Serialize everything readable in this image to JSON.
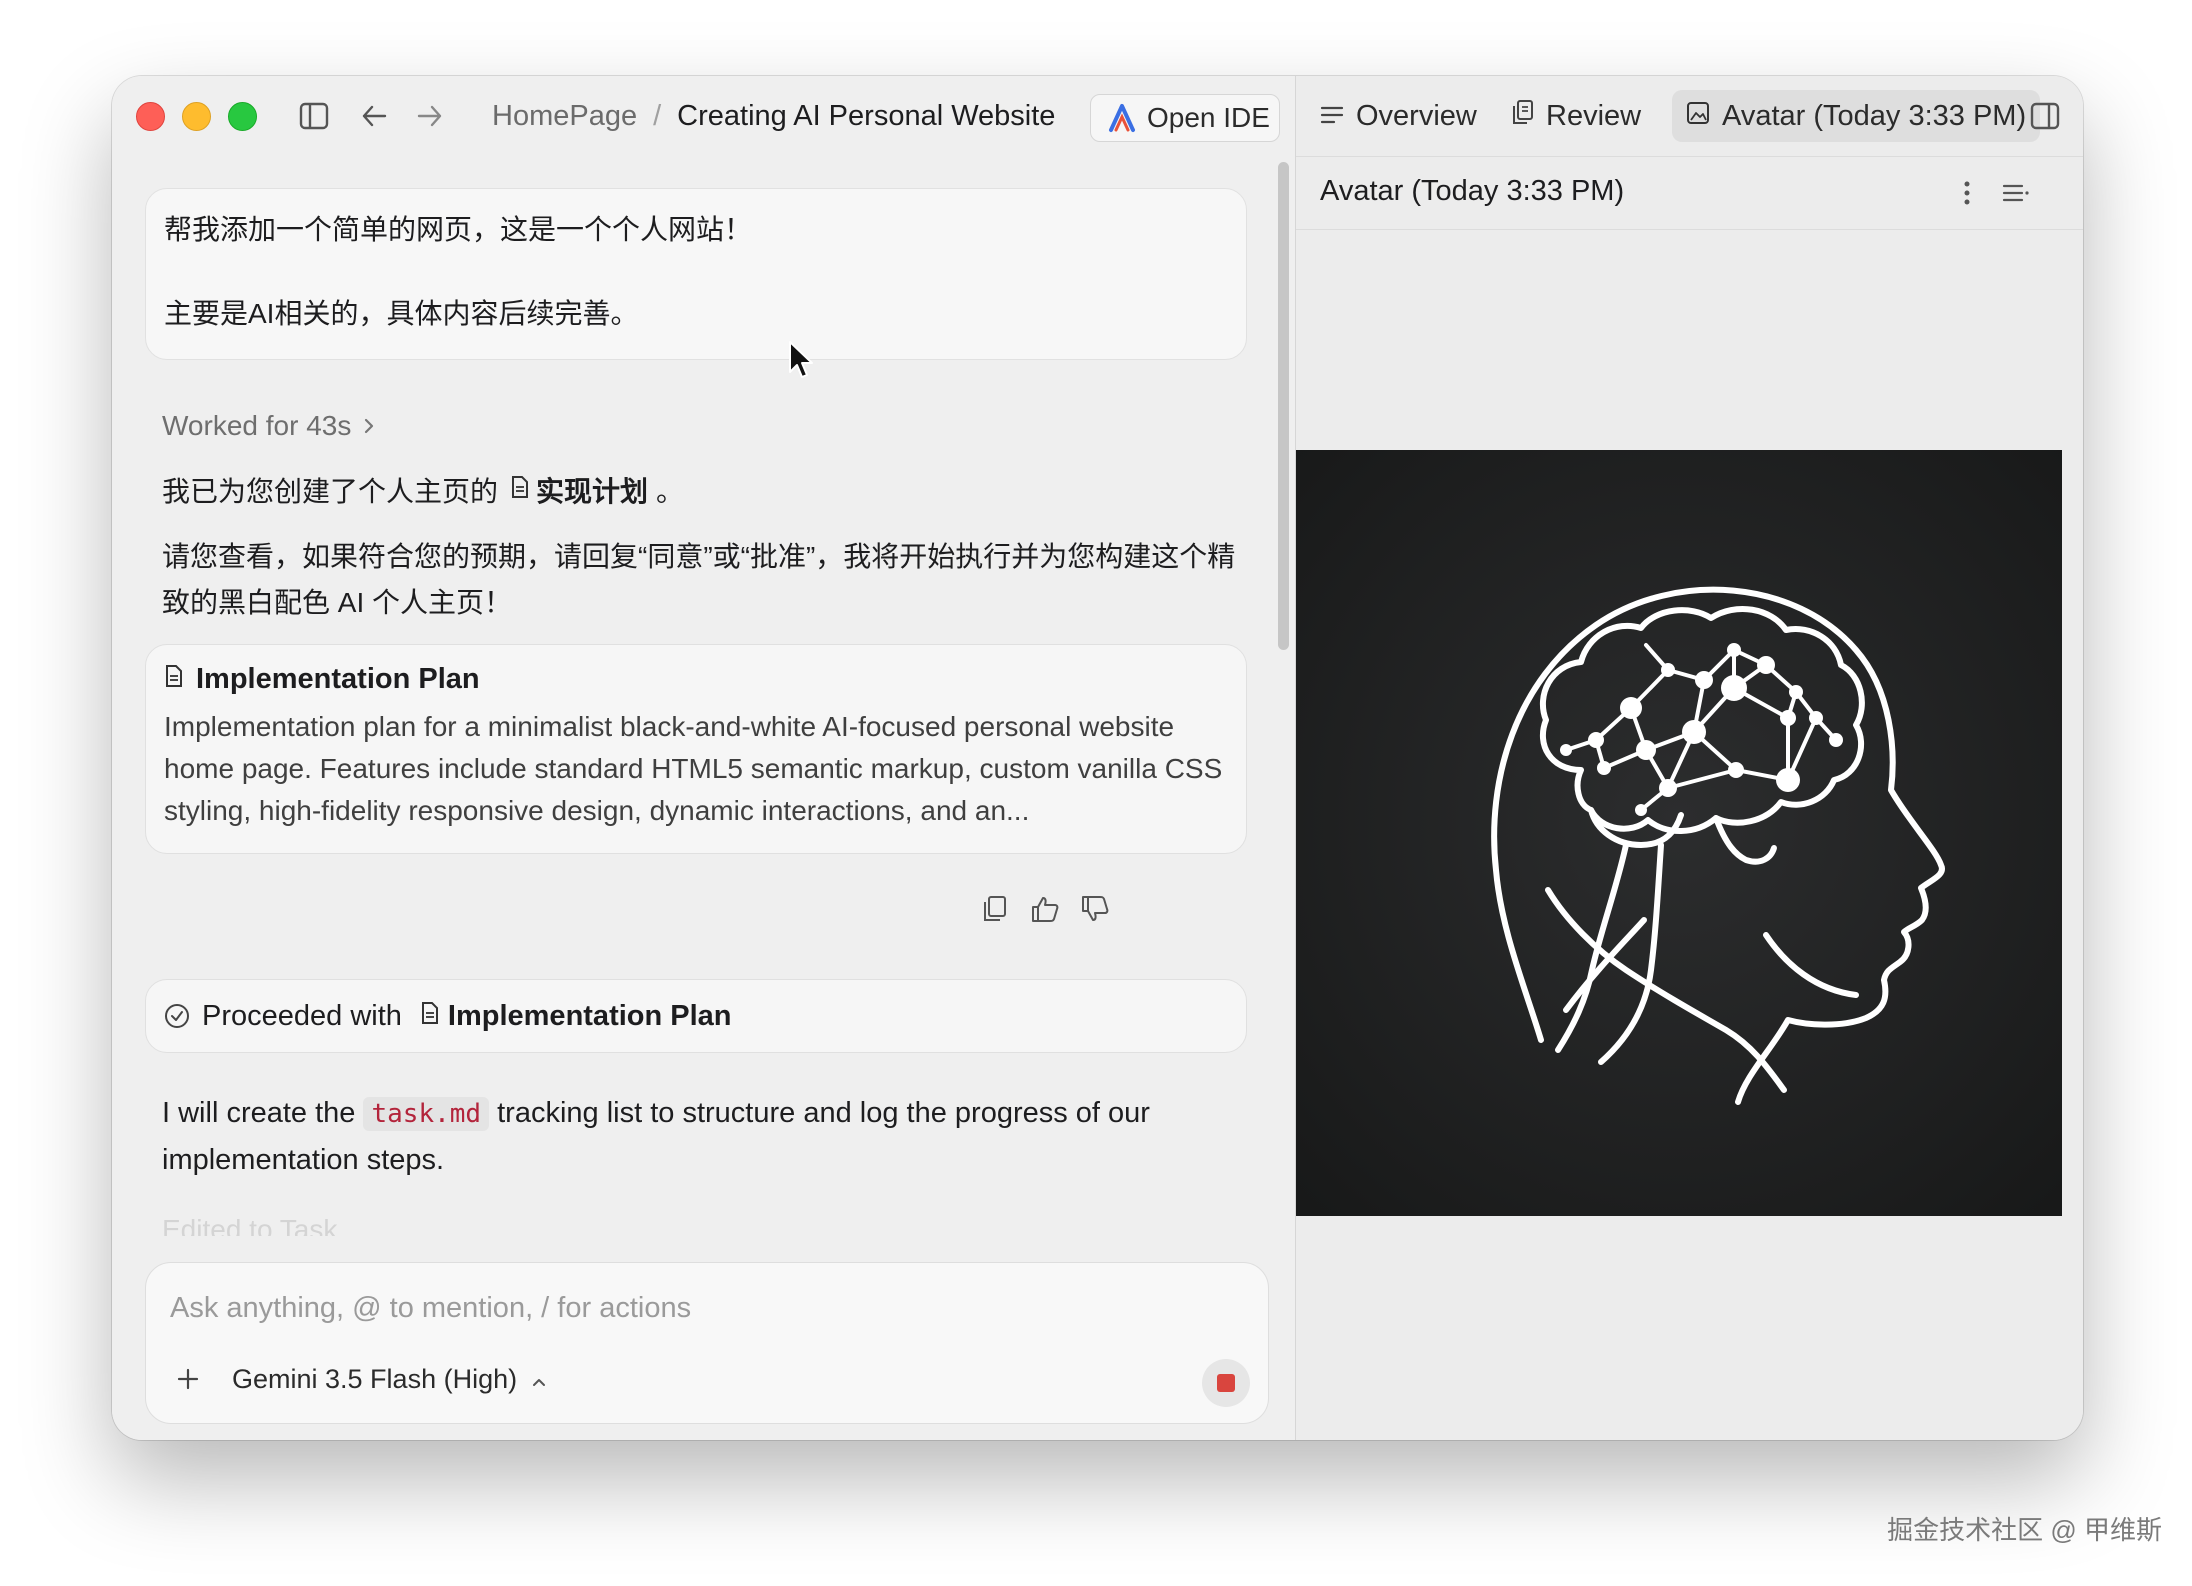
{
  "titlebar": {
    "breadcrumb_home": "HomePage",
    "breadcrumb_sep": "/",
    "breadcrumb_current": "Creating AI Personal Website",
    "open_ide_label": "Open IDE"
  },
  "conversation": {
    "user_message_line1": "帮我添加一个简单的网页，这是一个个人网站！",
    "user_message_line2": "主要是AI相关的，具体内容后续完善。",
    "worked_label": "Worked for 43s",
    "reply1_prefix": "我已为您创建了个人主页的",
    "reply1_link": "实现计划",
    "reply1_suffix": "。",
    "reply2": "请您查看，如果符合您的预期，请回复“同意”或“批准”，我将开始执行并为您构建这个精致的黑白配色 AI 个人主页！",
    "plan_card_title": "Implementation Plan",
    "plan_card_desc": "Implementation plan for a minimalist black-and-white AI-focused personal website home page. Features include standard HTML5 semantic markup, custom vanilla CSS styling, high-fidelity responsive design, dynamic interactions, and an...",
    "proceeded_prefix": "Proceeded with",
    "proceeded_link": "Implementation Plan",
    "reply3_before": "I will create the",
    "reply3_code": "task.md",
    "reply3_after": "tracking list to structure and log the progress of our implementation steps.",
    "faded_text": "Edited  to Task"
  },
  "composer": {
    "placeholder": "Ask anything, @ to mention, / for actions",
    "value": "",
    "model_label": "Gemini 3.5 Flash (High)"
  },
  "right_panel": {
    "tabs": [
      "Overview",
      "Review",
      "Avatar (Today 3:33 PM)"
    ],
    "active_tab": 2,
    "preview_title": "Avatar (Today 3:33 PM)"
  },
  "watermark": "掘金技术社区 @ 甲维斯",
  "colors": {
    "traffic_red": "#fe5f57",
    "traffic_yellow": "#febc2e",
    "traffic_green": "#28c840",
    "code_text": "#b3243b",
    "stop": "#d9453e",
    "avatar_bg": "#1f2021"
  },
  "icons": [
    "sidebar-toggle-icon",
    "back-arrow-icon",
    "forward-arrow-icon",
    "ide-logo-icon",
    "chevron-right-icon",
    "document-icon",
    "copy-icon",
    "thumbs-up-icon",
    "thumbs-down-icon",
    "check-circle-icon",
    "plus-icon",
    "chevron-up-icon",
    "stop-icon",
    "list-icon",
    "review-icon",
    "image-icon",
    "panel-toggle-icon",
    "kebab-icon",
    "outline-icon",
    "pointer-cursor-icon"
  ]
}
